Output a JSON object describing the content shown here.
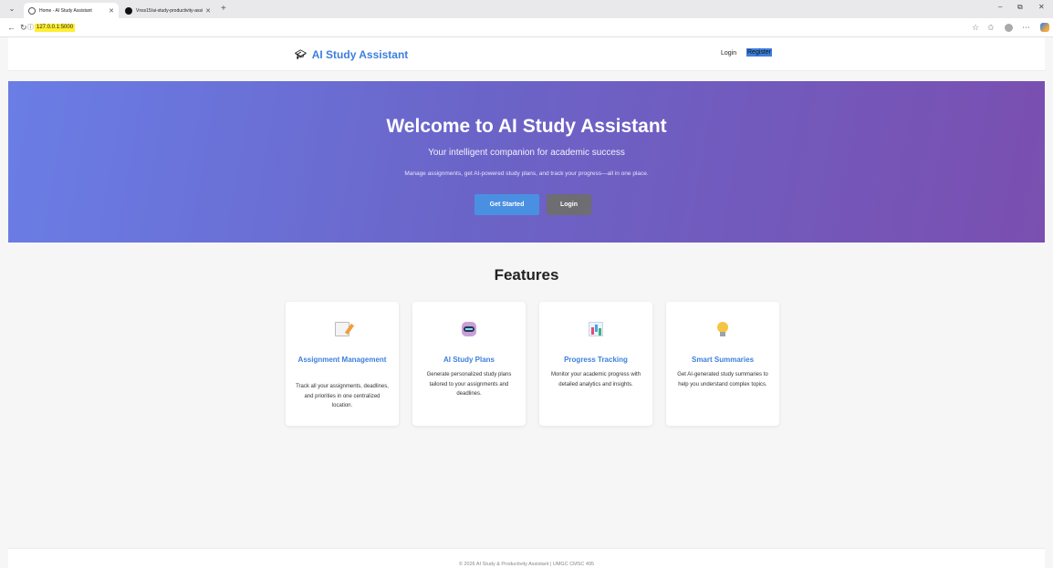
{
  "browser": {
    "tabs": [
      {
        "title": "Home - AI Study Assistant",
        "active": true
      },
      {
        "title": "Vnss15/ai-study-productivity-assi",
        "active": false
      }
    ],
    "new_tab": "+",
    "url": "127.0.0.1:5000",
    "window_controls": {
      "minimize": "–",
      "maximize": "⧉",
      "close": "✕"
    }
  },
  "nav": {
    "brand": "AI Study Assistant",
    "brand_icon": "graduation-cap-icon",
    "login": "Login",
    "register": "Register"
  },
  "hero": {
    "title": "Welcome to AI Study Assistant",
    "subtitle": "Your intelligent companion for academic success",
    "description": "Manage assignments, get AI-powered study plans, and track your progress—all in one place.",
    "primary_button": "Get Started",
    "secondary_button": "Login"
  },
  "features": {
    "title": "Features",
    "cards": [
      {
        "icon": "memo-icon",
        "title": "Assignment Management",
        "description": "Track all your assignments, deadlines, and priorities in one centralized location."
      },
      {
        "icon": "robot-icon",
        "title": "AI Study Plans",
        "description": "Generate personalized study plans tailored to your assignments and deadlines."
      },
      {
        "icon": "bar-chart-icon",
        "title": "Progress Tracking",
        "description": "Monitor your academic progress with detailed analytics and insights."
      },
      {
        "icon": "light-bulb-icon",
        "title": "Smart Summaries",
        "description": "Get AI-generated study summaries to help you understand complex topics."
      }
    ]
  },
  "footer": {
    "text": "© 2026 AI Study & Productivity Assistant | UMGC CMSC 495"
  },
  "colors": {
    "brand": "#3d7fdc",
    "hero_start": "#6a7ee6",
    "hero_end": "#7a4fb0",
    "primary_button": "#4a90e2",
    "secondary_button": "#6d6d72"
  }
}
